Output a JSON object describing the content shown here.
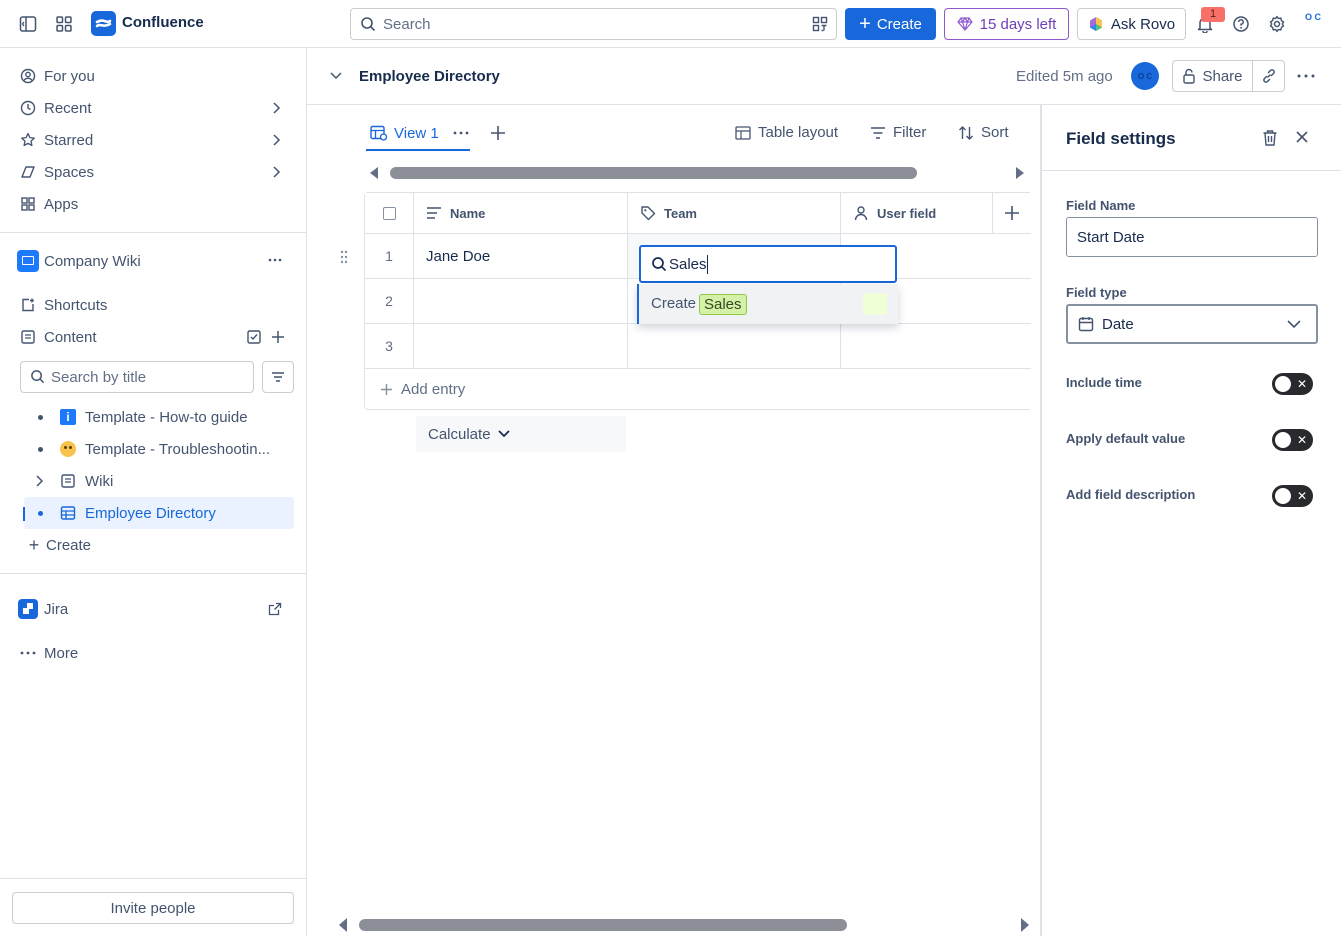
{
  "topbar": {
    "app_name": "Confluence",
    "search_placeholder": "Search",
    "create_label": "Create",
    "trial_label": "15 days left",
    "rovo_label": "Ask Rovo",
    "notification_count": "1",
    "avatar_initials": "O C"
  },
  "sidebar": {
    "nav": [
      {
        "label": "For you",
        "icon": "user-circle-icon"
      },
      {
        "label": "Recent",
        "icon": "clock-icon"
      },
      {
        "label": "Starred",
        "icon": "star-icon"
      },
      {
        "label": "Spaces",
        "icon": "spaces-icon"
      },
      {
        "label": "Apps",
        "icon": "apps-icon"
      }
    ],
    "space_name": "Company Wiki",
    "shortcuts_label": "Shortcuts",
    "content_label": "Content",
    "search_placeholder": "Search by title",
    "tree": [
      {
        "label": "Template - How-to guide",
        "icon": "info-icon"
      },
      {
        "label": "Template - Troubleshootin...",
        "icon": "emoji-icon"
      },
      {
        "label": "Wiki",
        "icon": "page-icon"
      },
      {
        "label": "Employee Directory",
        "icon": "database-icon",
        "active": true
      }
    ],
    "create_label": "Create",
    "jira_label": "Jira",
    "more_label": "More",
    "invite_label": "Invite people"
  },
  "page": {
    "title": "Employee Directory",
    "edited": "Edited 5m ago",
    "owner_initials": "O C",
    "share_label": "Share"
  },
  "database": {
    "view_label": "View 1",
    "toolbar": {
      "layout": "Table layout",
      "filter": "Filter",
      "sort": "Sort"
    },
    "columns": [
      {
        "label": "Name",
        "icon": "text-lines-icon"
      },
      {
        "label": "Team",
        "icon": "tag-icon"
      },
      {
        "label": "User field",
        "icon": "person-icon"
      }
    ],
    "rows": [
      {
        "num": "1",
        "name": "Jane Doe"
      },
      {
        "num": "2",
        "name": ""
      },
      {
        "num": "3",
        "name": ""
      }
    ],
    "add_entry_label": "Add entry",
    "calculate_label": "Calculate"
  },
  "dropdown": {
    "input_value": "Sales",
    "create_label": "Create",
    "chip_label": "Sales",
    "chip_color": "#d3f1a7"
  },
  "field_settings": {
    "title": "Field settings",
    "field_name_label": "Field Name",
    "field_name_value": "Start Date",
    "field_type_label": "Field type",
    "field_type_value": "Date",
    "toggles": [
      {
        "label": "Include time",
        "on": false
      },
      {
        "label": "Apply default value",
        "on": false
      },
      {
        "label": "Add field description",
        "on": false
      }
    ]
  },
  "colors": {
    "accent": "#1868db",
    "trial": "#8f5ad1",
    "toggle_off": "#292a2e"
  }
}
